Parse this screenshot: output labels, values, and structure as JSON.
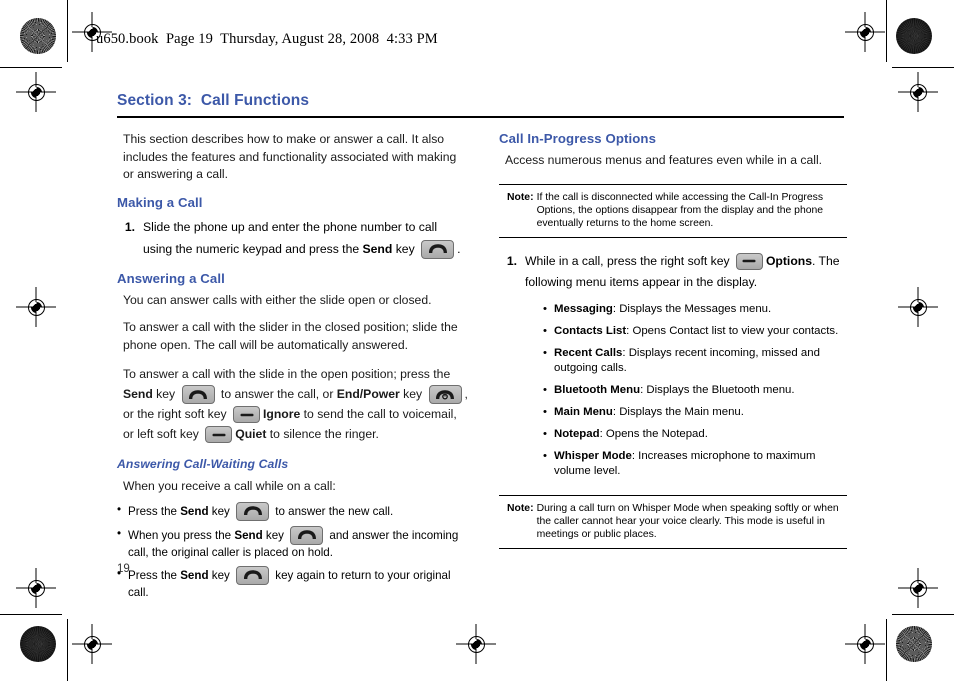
{
  "print_header": "u650.book  Page 19  Thursday, August 28, 2008  4:33 PM",
  "page_number": "19",
  "colors": {
    "heading_blue": "#3c58a8",
    "body_black": "#1a1a1a",
    "key_gray": "#b4b4b4"
  },
  "section": {
    "title": "Section 3:  Call Functions"
  },
  "left_column": {
    "intro": "This section describes how to make or answer a call. It also includes the features and functionality associated with making or answering a call.",
    "making_a_call": {
      "heading": "Making a Call",
      "step_number": "1.",
      "step_text_a": "Slide the phone up and enter the phone number to call using the numeric keypad and press the ",
      "step_bold": "Send",
      "step_text_b": " key ",
      "step_text_c": "."
    },
    "answering_a_call": {
      "heading": "Answering a Call",
      "para1": "You can answer calls with either the slide open or closed.",
      "para2": "To answer a call with the slider in the closed position; slide the phone open. The call will be automatically answered.",
      "para3_a": "To answer a call with the slide in the open position; press the ",
      "para3_send": "Send",
      "para3_b": " key ",
      "para3_c": " to answer the call, or ",
      "para3_end": "End/Power",
      "para3_d": " key ",
      "para3_e": ", or the right soft key ",
      "para3_ignore": "Ignore",
      "para3_f": " to send the call to voicemail, or left soft key ",
      "para3_quiet": "Quiet",
      "para3_g": " to silence the ringer."
    },
    "call_waiting": {
      "heading": "Answering Call-Waiting Calls",
      "intro": "When you receive a call while on a call:",
      "bullets": [
        {
          "pre": "Press the ",
          "bold": "Send",
          "mid": " key ",
          "post": " to answer the new call."
        },
        {
          "pre": "When you press the ",
          "bold": "Send",
          "mid": " key ",
          "post": " and answer the incoming call, the original caller is placed on hold."
        },
        {
          "pre": "Press the ",
          "bold": "Send",
          "mid": " key ",
          "post": " key again to return to your original call."
        }
      ]
    }
  },
  "right_column": {
    "heading": "Call In-Progress Options",
    "intro": "Access numerous menus and features even while in a call.",
    "note1": {
      "label": "Note:",
      "text": "If the call is disconnected while accessing the Call-In Progress Options, the options disappear from the display and the phone eventually returns to the home screen."
    },
    "step": {
      "number": "1.",
      "text_a": "While in a call, press the right soft key ",
      "bold": "Options",
      "text_b": ". The following menu items appear in the display."
    },
    "menu_items": [
      {
        "name": "Messaging",
        "desc": ": Displays the Messages menu."
      },
      {
        "name": "Contacts List",
        "desc": ": Opens Contact list to view your contacts."
      },
      {
        "name": "Recent Calls",
        "desc": ": Displays recent incoming, missed and outgoing calls."
      },
      {
        "name": "Bluetooth Menu",
        "desc": ": Displays the Bluetooth menu."
      },
      {
        "name": "Main Menu",
        "desc": ": Displays the Main menu."
      },
      {
        "name": "Notepad",
        "desc": ": Opens the Notepad."
      },
      {
        "name": "Whisper Mode",
        "desc": ": Increases microphone to maximum volume level."
      }
    ],
    "note2": {
      "label": "Note:",
      "text": "During a call turn on Whisper Mode when speaking softly or when the caller cannot hear your voice clearly. This mode is useful in meetings or public places."
    }
  },
  "icons": {
    "send_key": "phone-send-key-icon",
    "end_power_key": "phone-end-power-key-icon",
    "soft_key": "phone-soft-key-icon"
  }
}
